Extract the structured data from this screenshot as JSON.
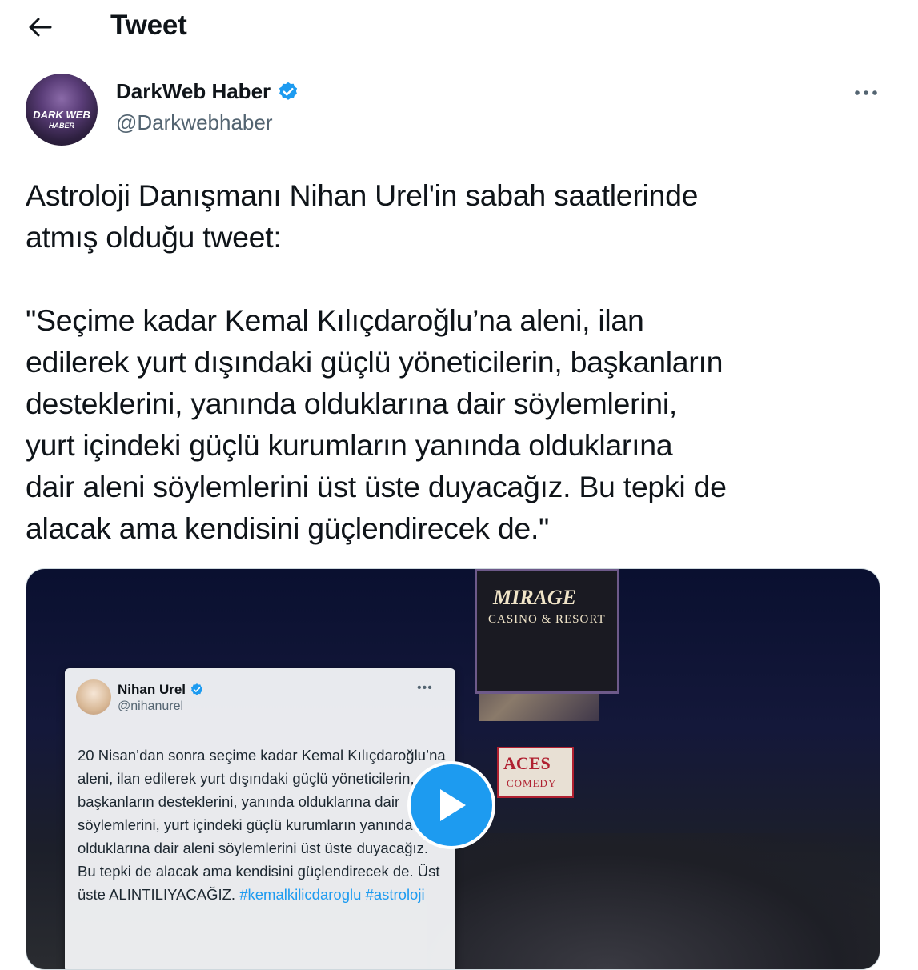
{
  "header": {
    "title": "Tweet"
  },
  "author": {
    "display_name": "DarkWeb Haber",
    "handle": "@Darkwebhaber",
    "avatar_text_1": "DARK WEB",
    "avatar_text_2": "HABER"
  },
  "tweet": {
    "text": "Astroloji Danışmanı Nihan Urel'in sabah saatlerinde\natmış olduğu tweet:\n\n\"Seçime kadar Kemal Kılıçdaroğlu’na aleni, ilan\nedilerek yurt dışındaki güçlü yöneticilerin, başkanların\ndesteklerini, yanında olduklarına dair söylemlerini,\nyurt içindeki güçlü kurumların yanında olduklarına\ndair aleni söylemlerini üst üste duyacağız. Bu tepki de\nalacak ama kendisini güçlendirecek de.\""
  },
  "media": {
    "sign_title": "MIRAGE",
    "sign_subtitle": "CASINO & RESORT",
    "aces_title": "ACES",
    "aces_subtitle": "COMEDY",
    "embedded_tweet": {
      "name": "Nihan Urel",
      "handle": "@nihanurel",
      "more": "•••",
      "text": "20 Nisan’dan sonra seçime kadar Kemal Kılıçdaroğlu’na aleni, ilan edilerek yurt dışındaki güçlü yöneticilerin, başkanların desteklerini, yanında olduklarına dair söylemlerini, yurt içindeki güçlü kurumların yanında olduklarına dair aleni söylemlerini üst üste duyacağız. Bu tepki de alacak ama kendisini güçlendirecek de. Üst üste ALINTILIYACAĞIZ.",
      "hashtag_1": "#kemalkilicdaroglu",
      "hashtag_2": "#astroloji"
    }
  },
  "colors": {
    "accent": "#1d9bf0",
    "secondary_text": "#536471",
    "primary_text": "#0f1419"
  },
  "icons": {
    "back": "arrow-left-icon",
    "verified": "verified-badge-icon",
    "more": "more-horizontal-icon",
    "play": "play-icon"
  }
}
